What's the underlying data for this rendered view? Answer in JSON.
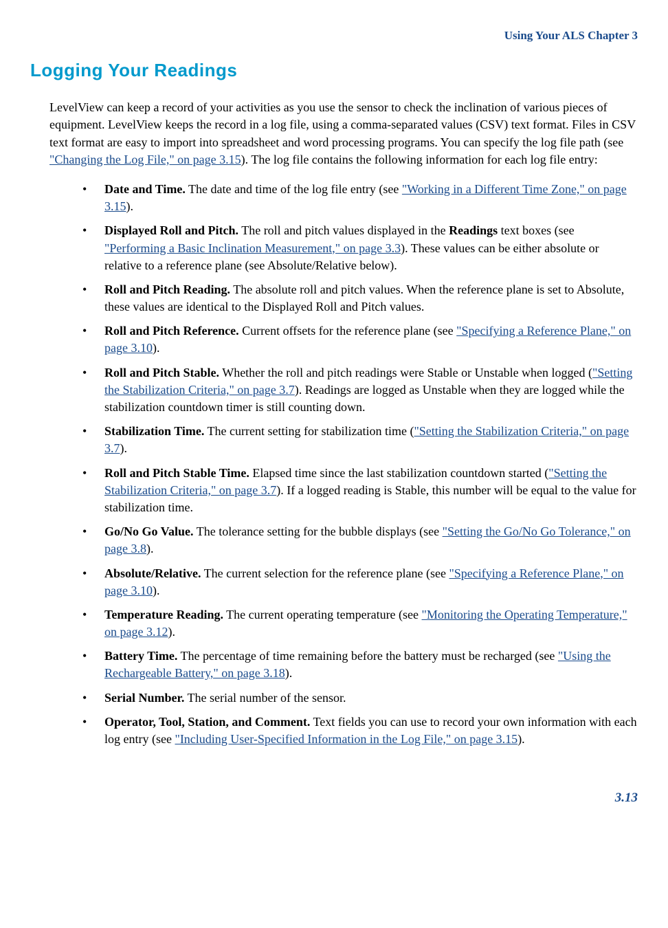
{
  "header": {
    "chapter": "Using Your ALS  Chapter 3"
  },
  "title": "Logging Your Readings",
  "intro": {
    "text1": "LevelView can keep a record of your activities as you use the sensor to check the inclination of various pieces of equipment. LevelView keeps the record in a log file, using a comma-separated values (CSV) text format. Files in CSV text format are easy to import into spreadsheet and word processing programs. You can specify the log file path (see ",
    "link1": "\"Changing the Log File,\" on page 3.15",
    "text2": "). The log file contains the following information for each log file entry:"
  },
  "items": [
    {
      "bold": "Date and Time.",
      "t1": " The date and time of the log file entry (see ",
      "l1": "\"Working in a Different Time Zone,\" on page 3.15",
      "t2": ")."
    },
    {
      "bold": "Displayed Roll and Pitch.",
      "t1": " The roll and pitch values displayed in the ",
      "b2": "Readings",
      "t2": " text boxes (see ",
      "l1": "\"Performing a Basic Inclination Measurement,\" on page 3.3",
      "t3": "). These values can be either absolute or relative to a reference plane (see Absolute/Relative below)."
    },
    {
      "bold": "Roll and Pitch Reading.",
      "t1": " The absolute roll and pitch values. When the reference plane is set to Absolute, these values are identical to the Displayed Roll and Pitch values."
    },
    {
      "bold": "Roll and Pitch Reference.",
      "t1": " Current offsets for the reference plane (see ",
      "l1": "\"Specifying a Reference Plane,\" on page 3.10",
      "t2": ")."
    },
    {
      "bold": "Roll and Pitch Stable.",
      "t1": " Whether the roll and pitch readings were Stable or Unstable when logged (",
      "l1": "\"Setting the Stabilization Criteria,\" on page 3.7",
      "t2": "). Readings are logged as Unstable when they are logged while the stabilization countdown timer is still counting down."
    },
    {
      "bold": "Stabilization Time.",
      "t1": " The current setting for stabilization time (",
      "l1": "\"Setting the Stabilization Criteria,\" on page 3.7",
      "t2": ")."
    },
    {
      "bold": "Roll and Pitch Stable Time.",
      "t1": " Elapsed time since the last stabilization countdown started (",
      "l1": "\"Setting the Stabilization Criteria,\" on page 3.7",
      "t2": "). If a logged reading is Stable, this number will be equal to the value for stabilization time."
    },
    {
      "bold": "Go/No Go Value.",
      "t1": " The tolerance setting for the bubble displays (see ",
      "l1": "\"Setting the Go/No Go Tolerance,\" on page 3.8",
      "t2": ")."
    },
    {
      "bold": "Absolute/Relative.",
      "t1": " The current selection for the reference plane (see ",
      "l1": "\"Specifying a Reference Plane,\" on page 3.10",
      "t2": ")."
    },
    {
      "bold": "Temperature Reading.",
      "t1": " The current operating temperature (see ",
      "l1": "\"Monitoring the Operating Temperature,\" on page 3.12",
      "t2": ")."
    },
    {
      "bold": "Battery Time.",
      "t1": " The percentage of time remaining before the battery must be recharged (see ",
      "l1": "\"Using the Rechargeable Battery,\" on page 3.18",
      "t2": ")."
    },
    {
      "bold": "Serial Number.",
      "t1": " The serial number of the sensor."
    },
    {
      "bold": "Operator, Tool, Station, and Comment.",
      "t1": " Text fields you can use to record your own information with each log entry (see ",
      "l1": "\"Including User-Specified Information in the Log File,\" on page 3.15",
      "t2": ")."
    }
  ],
  "footer": {
    "page": "3.13"
  }
}
